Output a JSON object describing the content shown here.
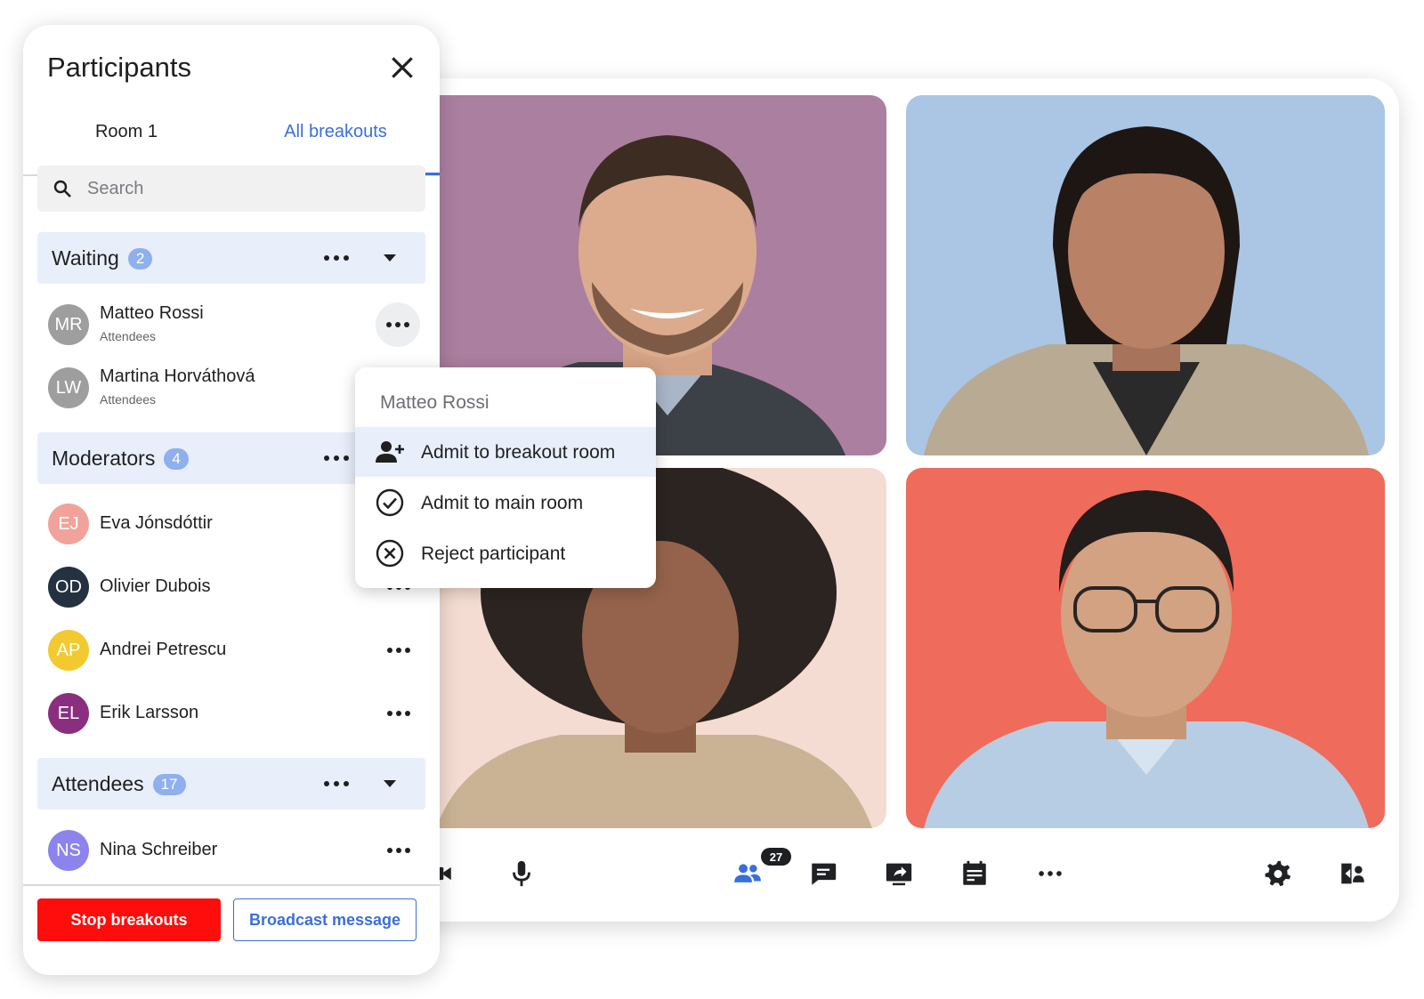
{
  "panel": {
    "title": "Participants",
    "close_icon": "close-icon",
    "tabs": [
      {
        "label": "Room 1",
        "active": false
      },
      {
        "label": "All breakouts",
        "active": true
      }
    ],
    "search": {
      "placeholder": "Search",
      "value": ""
    },
    "sections": {
      "waiting": {
        "label": "Waiting",
        "count": "2"
      },
      "moderators": {
        "label": "Moderators",
        "count": "4"
      },
      "attendees": {
        "label": "Attendees",
        "count": "17"
      }
    },
    "waiting_people": [
      {
        "initials": "MR",
        "name": "Matteo Rossi",
        "role": "Attendees",
        "color": "#9e9e9e"
      },
      {
        "initials": "LW",
        "name": "Martina Horváthová",
        "role": "Attendees",
        "color": "#9e9e9e"
      }
    ],
    "moderator_people": [
      {
        "initials": "EJ",
        "name": "Eva Jónsdóttir",
        "color": "#f1a39b"
      },
      {
        "initials": "OD",
        "name": "Olivier Dubois",
        "color": "#233141"
      },
      {
        "initials": "AP",
        "name": "Andrei Petrescu",
        "color": "#f2ca2f"
      },
      {
        "initials": "EL",
        "name": "Erik Larsson",
        "color": "#8a2f7f"
      }
    ],
    "attendee_people": [
      {
        "initials": "NS",
        "name": "Nina Schreiber",
        "color": "#8d83ec"
      }
    ],
    "footer": {
      "stop_label": "Stop breakouts",
      "broadcast_label": "Broadcast message"
    }
  },
  "context_menu": {
    "title": "Matteo Rossi",
    "items": [
      {
        "label": "Admit to breakout room",
        "icon": "person-add-icon",
        "highlighted": true
      },
      {
        "label": "Admit to main room",
        "icon": "check-circle-icon",
        "highlighted": false
      },
      {
        "label": "Reject participant",
        "icon": "x-circle-icon",
        "highlighted": false
      }
    ]
  },
  "video_tiles": [
    {
      "name": "tile-1",
      "background": "#ab7f9f"
    },
    {
      "name": "tile-2",
      "background": "#aac6e4"
    },
    {
      "name": "tile-3",
      "background": "#f4dcd2"
    },
    {
      "name": "tile-4",
      "background": "#ef6b5b"
    }
  ],
  "toolbar": {
    "participants_badge": "27",
    "accent_color": "#3b6fd8",
    "icons": [
      "camera-icon",
      "microphone-icon",
      "participants-icon",
      "chat-icon",
      "screen-share-icon",
      "agenda-icon",
      "more-icon",
      "settings-icon",
      "layout-icon"
    ]
  },
  "colors": {
    "accent": "#3b6fd8",
    "danger": "#ff0c0c",
    "section_bg": "#e8eefa"
  }
}
